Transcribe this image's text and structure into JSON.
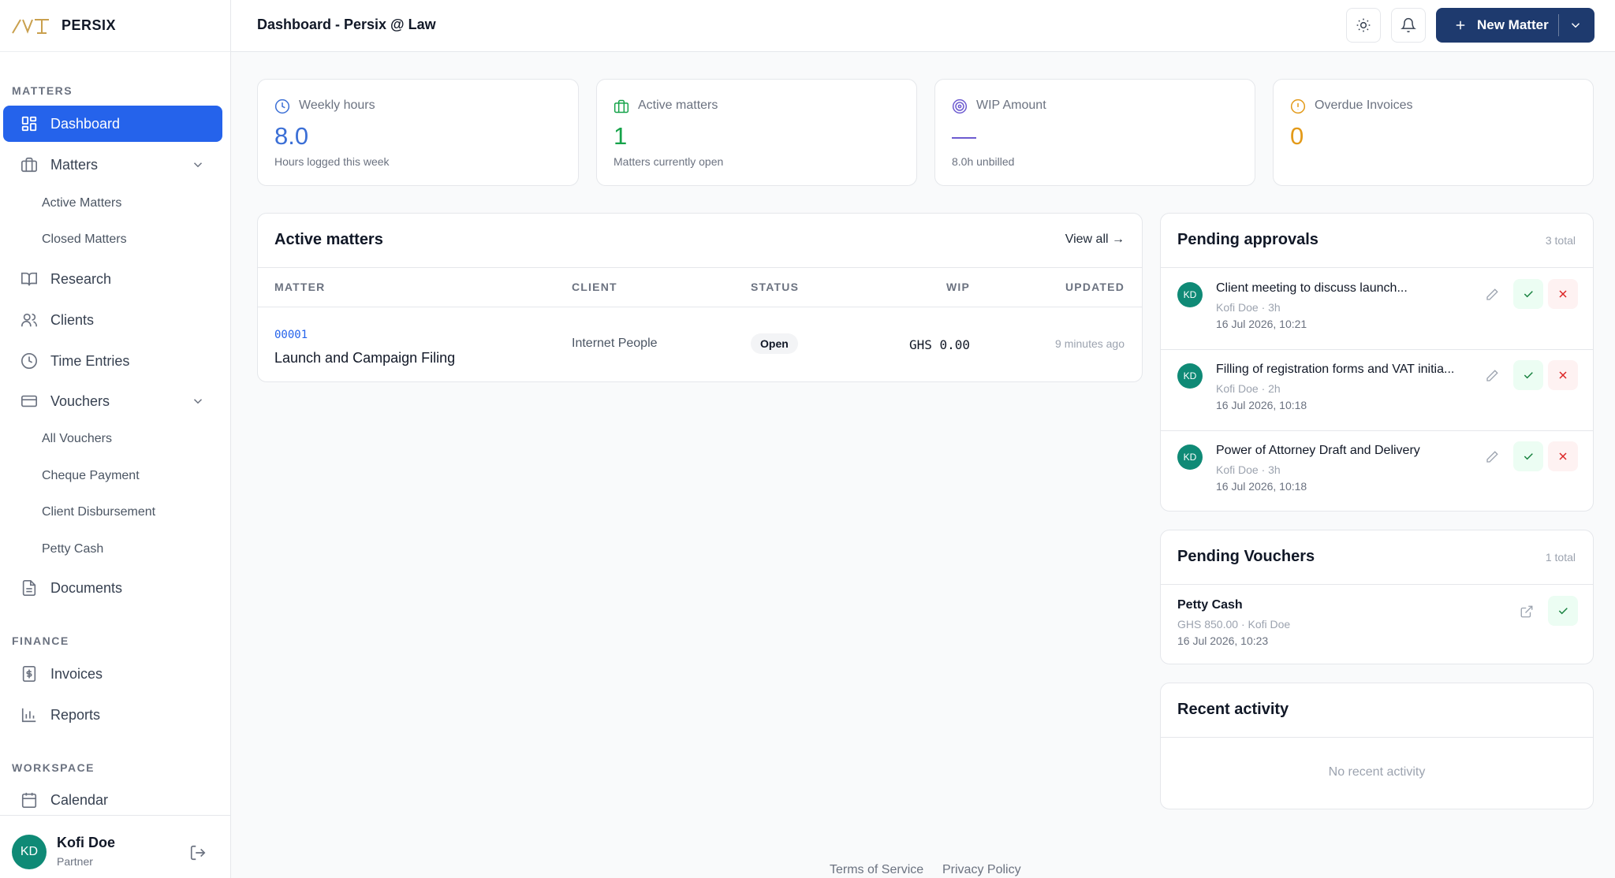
{
  "brand": {
    "name": "PERSIX"
  },
  "sidebar": {
    "sections": {
      "matters": "MATTERS",
      "finance": "FINANCE",
      "workspace": "WORKSPACE"
    },
    "items": {
      "dashboard": "Dashboard",
      "matters": "Matters",
      "active_matters": "Active Matters",
      "closed_matters": "Closed Matters",
      "research": "Research",
      "clients": "Clients",
      "time_entries": "Time Entries",
      "vouchers": "Vouchers",
      "all_vouchers": "All Vouchers",
      "cheque_payment": "Cheque Payment",
      "client_disbursement": "Client Disbursement",
      "petty_cash": "Petty Cash",
      "documents": "Documents",
      "invoices": "Invoices",
      "reports": "Reports",
      "calendar": "Calendar"
    },
    "user": {
      "initials": "KD",
      "name": "Kofi Doe",
      "role": "Partner"
    }
  },
  "header": {
    "title": "Dashboard - Persix @ Law",
    "new_button": "New Matter"
  },
  "stats": [
    {
      "label": "Weekly hours",
      "value": "8.0",
      "sub": "Hours logged this week",
      "color": "#3b6fd6",
      "icon": "clock-icon"
    },
    {
      "label": "Active matters",
      "value": "1",
      "sub": "Matters currently open",
      "color": "#16a34a",
      "icon": "briefcase-icon"
    },
    {
      "label": "WIP Amount",
      "value": "—",
      "sub": "8.0h unbilled",
      "color": "#6d5bd0",
      "icon": "target-icon"
    },
    {
      "label": "Overdue Invoices",
      "value": "0",
      "sub": "",
      "color": "#e39a19",
      "icon": "alert-circle-icon"
    }
  ],
  "active_matters": {
    "title": "Active matters",
    "view_all": "View all →",
    "columns": [
      "MATTER",
      "CLIENT",
      "STATUS",
      "WIP",
      "UPDATED"
    ],
    "rows": [
      {
        "code": "00001",
        "name": "Launch and Campaign Filing",
        "client": "Internet People",
        "status": "Open",
        "wip": "GHS 0.00",
        "updated": "9 minutes ago"
      }
    ]
  },
  "pending_approvals": {
    "title": "Pending approvals",
    "count": "3 total",
    "items": [
      {
        "initials": "KD",
        "title": "Client meeting to discuss launch...",
        "meta": "Kofi Doe · 3h",
        "date": "16 Jul 2026, 10:21"
      },
      {
        "initials": "KD",
        "title": "Filling of registration forms and VAT initia...",
        "meta": "Kofi Doe · 2h",
        "date": "16 Jul 2026, 10:18"
      },
      {
        "initials": "KD",
        "title": "Power of Attorney Draft and Delivery",
        "meta": "Kofi Doe · 3h",
        "date": "16 Jul 2026, 10:18"
      }
    ]
  },
  "pending_vouchers": {
    "title": "Pending Vouchers",
    "count": "1 total",
    "items": [
      {
        "title": "Petty Cash",
        "meta": "GHS 850.00 · Kofi Doe",
        "date": "16 Jul 2026, 10:23"
      }
    ]
  },
  "recent_activity": {
    "title": "Recent activity",
    "empty": "No recent activity"
  },
  "footer": {
    "terms": "Terms of Service",
    "privacy": "Privacy Policy"
  },
  "colors": {
    "primary": "#2563eb",
    "navy": "#1e3a6e",
    "avatar": "#0f8a76"
  }
}
